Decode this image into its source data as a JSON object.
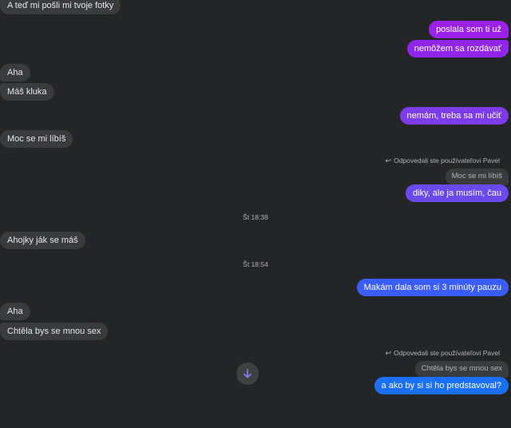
{
  "colors": {
    "background": "#242526",
    "incoming_bubble": "#3a3b3c",
    "outgoing_purple": "#9b20ea",
    "outgoing_violet": "#7d3bea",
    "outgoing_blue": "#3b5cff",
    "outgoing_azure": "#1a6ff5",
    "scroll_icon": "#8f7ef5"
  },
  "messages": {
    "m1": "A teď mi pošli mi tvoje fotky",
    "m2": "poslala som ti už",
    "m3": "nemôžem sa rozdávať",
    "m4": "Aha",
    "m5": "Máš kluka",
    "m6": "nemám, treba sa mi učiť",
    "m7": "Moc se mi líbíš",
    "m8": "diky, ale ja musím, čau",
    "m9": "Ahojky ják se máš",
    "m10": "Makám dala som si 3 minúty pauzu",
    "m11": "Aha",
    "m12": "Chtěla bys se mnou sex",
    "m13": "a ako by si si ho predstavoval?"
  },
  "replies": {
    "r1": {
      "note": "Odpovedali ste používateľovi Pavel",
      "quote": "Moc se mi líbíš"
    },
    "r2": {
      "note": "Odpovedali ste používateľovi Pavel",
      "quote": "Chtěla bys se mnou sex"
    }
  },
  "timestamps": {
    "t1": "Št 18:38",
    "t2": "Št 18:54"
  },
  "icons": {
    "reply": "reply-arrow-icon",
    "scroll": "arrow-down-icon"
  }
}
